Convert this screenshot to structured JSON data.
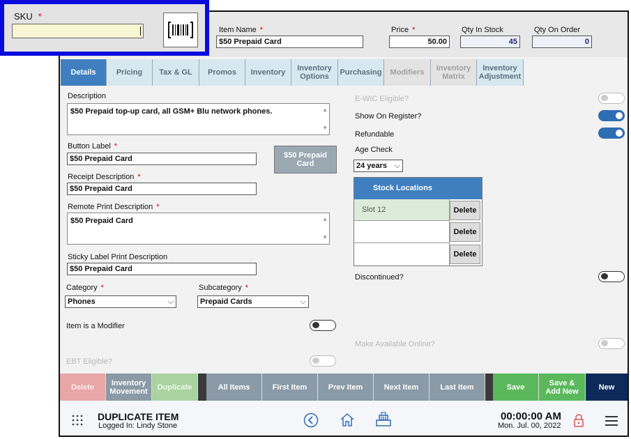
{
  "sku": {
    "label": "SKU",
    "value": "",
    "required": "*"
  },
  "item_name": {
    "label": "Item Name",
    "value": "$50 Prepaid Card",
    "required": "*"
  },
  "price": {
    "label": "Price",
    "value": "50.00",
    "required": "*"
  },
  "qty_in_stock": {
    "label": "Qty In Stock",
    "value": "45"
  },
  "qty_on_order": {
    "label": "Qty On Order",
    "value": "0"
  },
  "tabs": [
    {
      "label": "Details",
      "state": "active"
    },
    {
      "label": "Pricing",
      "state": "normal"
    },
    {
      "label": "Tax & GL",
      "state": "normal"
    },
    {
      "label": "Promos",
      "state": "normal"
    },
    {
      "label": "Inventory",
      "state": "normal"
    },
    {
      "label": "Inventory Options",
      "state": "normal"
    },
    {
      "label": "Purchasing",
      "state": "normal"
    },
    {
      "label": "Modifiers",
      "state": "disabled"
    },
    {
      "label": "Inventory Matrix",
      "state": "disabled"
    },
    {
      "label": "Inventory Adjustment",
      "state": "normal"
    }
  ],
  "left": {
    "description": {
      "label": "Description",
      "value": "$50 Prepaid top-up card, all GSM+ Blu network phones."
    },
    "button_label": {
      "label": "Button Label",
      "value": "$50 Prepaid Card",
      "required": "*"
    },
    "button_preview": "$50 Prepaid Card",
    "receipt_description": {
      "label": "Receipt Description",
      "value": "$50 Prepaid Card",
      "required": "*"
    },
    "remote_print_description": {
      "label": "Remote Print Description",
      "value": "$50 Prepaid Card",
      "required": "*"
    },
    "sticky_label": {
      "label": "Sticky Label Print Description",
      "value": "$50 Prepaid Card"
    },
    "category": {
      "label": "Category",
      "value": "Phones",
      "required": "*"
    },
    "subcategory": {
      "label": "Subcategory",
      "value": "Prepaid Cards",
      "required": "*"
    },
    "is_modifier": {
      "label": "Item is a Modifier",
      "on": false
    },
    "ebt_eligible": {
      "label": "EBT Eligible?",
      "on": false
    }
  },
  "right": {
    "ewic": {
      "label": "E-WIC Eligible?",
      "on": false
    },
    "show_on_register": {
      "label": "Show On Register?",
      "on": true
    },
    "refundable": {
      "label": "Refundable",
      "on": true
    },
    "age_check": {
      "label": "Age Check",
      "value": "24 years"
    },
    "stock_locations": {
      "title": "Stock Locations",
      "rows": [
        {
          "location": "Slot 12",
          "delete": "Delete"
        },
        {
          "location": "",
          "delete": "Delete"
        },
        {
          "location": "",
          "delete": "Delete"
        }
      ]
    },
    "discontinued": {
      "label": "Discontinued?",
      "on": false
    },
    "available_online": {
      "label": "Make Available Online?",
      "on": false
    }
  },
  "actions": {
    "delete": "Delete",
    "inventory_movement": "Inventory Movement",
    "duplicate": "Duplicate",
    "all_items": "All Items",
    "first_item": "First Item",
    "prev_item": "Prev Item",
    "next_item": "Next Item",
    "last_item": "Last Item",
    "save": "Save",
    "save_add_new": "Save & Add New",
    "new": "New"
  },
  "footer": {
    "title": "DUPLICATE ITEM",
    "logged_in": "Logged In:  Lindy Stone",
    "time": "00:00:00 AM",
    "date": "Mon. Jul. 00, 2022"
  },
  "colors": {
    "highlight_border": "#0a0adc",
    "tab_active": "#3f7fbf",
    "save_green": "#5cb85c",
    "new_navy": "#0e2a5a",
    "nav_gray": "#8a9aa6",
    "delete_red": "#e8a6a6"
  }
}
